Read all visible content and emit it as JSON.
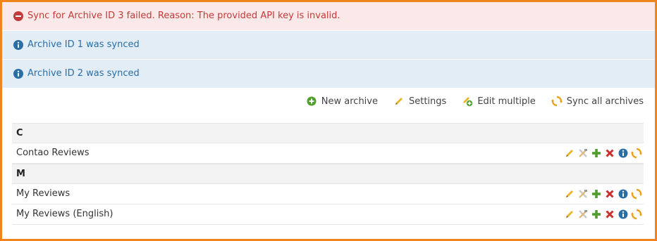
{
  "messages": {
    "error": "Sync for Archive ID 3 failed. Reason: The provided API key is invalid.",
    "info1": "Archive ID 1 was synced",
    "info2": "Archive ID 2 was synced"
  },
  "toolbar": {
    "new_archive": "New archive",
    "settings": "Settings",
    "edit_multiple": "Edit multiple",
    "sync_all": "Sync all archives"
  },
  "list": {
    "groups": [
      {
        "label": "C",
        "items": [
          {
            "label": "Contao Reviews"
          }
        ]
      },
      {
        "label": "M",
        "items": [
          {
            "label": "My Reviews"
          },
          {
            "label": "My Reviews (English)"
          }
        ]
      }
    ]
  },
  "icons": {
    "error": "circle-minus-icon",
    "info": "info-circle-icon",
    "new": "plus-circle-icon",
    "settings": "pencil-icon",
    "edit_multiple": "pencil-plus-icon",
    "sync": "sync-icon",
    "row_ops": [
      "edit-icon",
      "edit-header-icon",
      "copy-icon",
      "delete-icon",
      "info-icon",
      "sync-icon"
    ]
  },
  "colors": {
    "frame": "#f0851e",
    "error_bg": "#fbe8e8",
    "error_text": "#c33a3a",
    "info_bg": "#e3edf6",
    "info_text": "#2a6ea6"
  }
}
